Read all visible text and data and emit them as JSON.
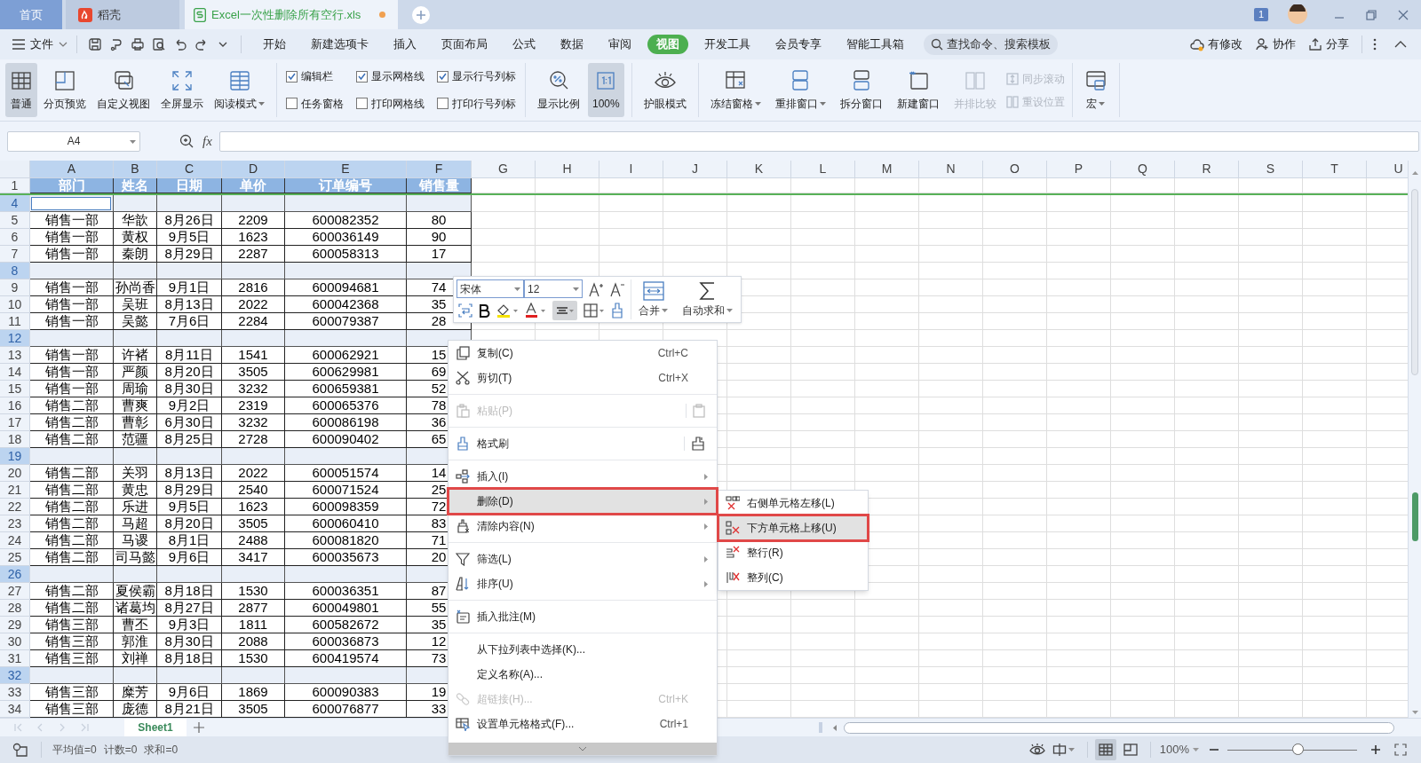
{
  "title_tabs": [
    {
      "kind": "home",
      "label": "首页",
      "selected": false
    },
    {
      "kind": "docer",
      "label": "稻壳",
      "selected": false
    },
    {
      "kind": "sheet",
      "label": "Excel一次性删除所有空行.xls",
      "selected": true,
      "modified": true
    }
  ],
  "notification_count": "1",
  "menu_bar": {
    "file_label": "文件",
    "tabs": [
      {
        "label": "开始",
        "selected": false
      },
      {
        "label": "新建选项卡",
        "selected": false
      },
      {
        "label": "插入",
        "selected": false
      },
      {
        "label": "页面布局",
        "selected": false
      },
      {
        "label": "公式",
        "selected": false
      },
      {
        "label": "数据",
        "selected": false
      },
      {
        "label": "审阅",
        "selected": false
      },
      {
        "label": "视图",
        "selected": true
      },
      {
        "label": "开发工具",
        "selected": false
      },
      {
        "label": "会员专享",
        "selected": false
      },
      {
        "label": "智能工具箱",
        "selected": false
      }
    ],
    "search_placeholder": "查找命令、搜索模板",
    "actions": [
      "有修改",
      "协作",
      "分享"
    ]
  },
  "ribbon": {
    "view_buttons": [
      {
        "label": "普通",
        "selected": true,
        "dropdown": false
      },
      {
        "label": "分页预览",
        "selected": false,
        "dropdown": false
      },
      {
        "label": "自定义视图",
        "selected": false,
        "dropdown": false
      },
      {
        "label": "全屏显示",
        "selected": false,
        "dropdown": false
      },
      {
        "label": "阅读模式",
        "selected": false,
        "dropdown": true
      }
    ],
    "checkboxes": [
      {
        "label": "编辑栏",
        "checked": true
      },
      {
        "label": "任务窗格",
        "checked": false
      },
      {
        "label": "显示网格线",
        "checked": true
      },
      {
        "label": "打印网格线",
        "checked": false
      },
      {
        "label": "显示行号列标",
        "checked": true
      },
      {
        "label": "打印行号列标",
        "checked": false
      }
    ],
    "zoom_buttons": [
      {
        "label": "显示比例",
        "selected": false
      },
      {
        "label": "100%",
        "selected": true
      }
    ],
    "eye_button": "护眼模式",
    "window_buttons": [
      {
        "label": "冻结窗格",
        "dropdown": true,
        "disabled": false
      },
      {
        "label": "重排窗口",
        "dropdown": true,
        "disabled": false
      },
      {
        "label": "拆分窗口",
        "dropdown": false,
        "disabled": false
      },
      {
        "label": "新建窗口",
        "dropdown": false,
        "disabled": false
      },
      {
        "label": "并排比较",
        "dropdown": false,
        "disabled": true
      }
    ],
    "small_buttons": [
      {
        "label": "同步滚动",
        "disabled": true
      },
      {
        "label": "重设位置",
        "disabled": true
      }
    ],
    "macro_button": "宏"
  },
  "formula_bar": {
    "name_box": "A4",
    "fx": "fx"
  },
  "sheet": {
    "columns": [
      {
        "label": "A",
        "selected": true
      },
      {
        "label": "B",
        "selected": true
      },
      {
        "label": "C",
        "selected": true
      },
      {
        "label": "D",
        "selected": true
      },
      {
        "label": "E",
        "selected": true
      },
      {
        "label": "F",
        "selected": true
      },
      {
        "label": "G",
        "selected": false
      },
      {
        "label": "H",
        "selected": false
      },
      {
        "label": "I",
        "selected": false
      },
      {
        "label": "J",
        "selected": false
      },
      {
        "label": "K",
        "selected": false
      },
      {
        "label": "L",
        "selected": false
      },
      {
        "label": "M",
        "selected": false
      },
      {
        "label": "N",
        "selected": false
      },
      {
        "label": "O",
        "selected": false
      },
      {
        "label": "P",
        "selected": false
      },
      {
        "label": "Q",
        "selected": false
      },
      {
        "label": "R",
        "selected": false
      },
      {
        "label": "S",
        "selected": false
      },
      {
        "label": "T",
        "selected": false
      },
      {
        "label": "U",
        "selected": false
      }
    ],
    "rows": [
      {
        "number": "1",
        "kind": "header",
        "selected": false,
        "cells": [
          "部门",
          "姓名",
          "日期",
          "单价",
          "订单编号",
          "销售量"
        ]
      },
      {
        "number": "4",
        "kind": "empty",
        "selected": true,
        "cursor": true
      },
      {
        "number": "5",
        "kind": "data",
        "selected": false,
        "cells": [
          "销售一部",
          "华歆",
          "8月26日",
          "2209",
          "600082352",
          "80"
        ]
      },
      {
        "number": "6",
        "kind": "data",
        "selected": false,
        "cells": [
          "销售一部",
          "黄权",
          "9月5日",
          "1623",
          "600036149",
          "90"
        ]
      },
      {
        "number": "7",
        "kind": "data",
        "selected": false,
        "cells": [
          "销售一部",
          "秦朗",
          "8月29日",
          "2287",
          "600058313",
          "17"
        ]
      },
      {
        "number": "8",
        "kind": "empty",
        "selected": true
      },
      {
        "number": "9",
        "kind": "data",
        "selected": false,
        "cells": [
          "销售一部",
          "孙尚香",
          "9月1日",
          "2816",
          "600094681",
          "74"
        ]
      },
      {
        "number": "10",
        "kind": "data",
        "selected": false,
        "cells": [
          "销售一部",
          "吴班",
          "8月13日",
          "2022",
          "600042368",
          "35"
        ]
      },
      {
        "number": "11",
        "kind": "data",
        "selected": false,
        "cells": [
          "销售一部",
          "吴懿",
          "7月6日",
          "2284",
          "600079387",
          "28"
        ]
      },
      {
        "number": "12",
        "kind": "empty",
        "selected": true
      },
      {
        "number": "13",
        "kind": "data",
        "selected": false,
        "cells": [
          "销售一部",
          "许褚",
          "8月11日",
          "1541",
          "600062921",
          "15"
        ]
      },
      {
        "number": "14",
        "kind": "data",
        "selected": false,
        "cells": [
          "销售一部",
          "严颜",
          "8月20日",
          "3505",
          "600629981",
          "69"
        ]
      },
      {
        "number": "15",
        "kind": "data",
        "selected": false,
        "cells": [
          "销售一部",
          "周瑜",
          "8月30日",
          "3232",
          "600659381",
          "52"
        ]
      },
      {
        "number": "16",
        "kind": "data",
        "selected": false,
        "cells": [
          "销售二部",
          "曹爽",
          "9月2日",
          "2319",
          "600065376",
          "78"
        ]
      },
      {
        "number": "17",
        "kind": "data",
        "selected": false,
        "cells": [
          "销售二部",
          "曹彰",
          "6月30日",
          "3232",
          "600086198",
          "36"
        ]
      },
      {
        "number": "18",
        "kind": "data",
        "selected": false,
        "cells": [
          "销售二部",
          "范疆",
          "8月25日",
          "2728",
          "600090402",
          "65"
        ]
      },
      {
        "number": "19",
        "kind": "empty",
        "selected": true
      },
      {
        "number": "20",
        "kind": "data",
        "selected": false,
        "cells": [
          "销售二部",
          "关羽",
          "8月13日",
          "2022",
          "600051574",
          "14"
        ]
      },
      {
        "number": "21",
        "kind": "data",
        "selected": false,
        "cells": [
          "销售二部",
          "黄忠",
          "8月29日",
          "2540",
          "600071524",
          "25"
        ]
      },
      {
        "number": "22",
        "kind": "data",
        "selected": false,
        "cells": [
          "销售二部",
          "乐进",
          "9月5日",
          "1623",
          "600098359",
          "72"
        ]
      },
      {
        "number": "23",
        "kind": "data",
        "selected": false,
        "cells": [
          "销售二部",
          "马超",
          "8月20日",
          "3505",
          "600060410",
          "83"
        ]
      },
      {
        "number": "24",
        "kind": "data",
        "selected": false,
        "cells": [
          "销售二部",
          "马谡",
          "8月1日",
          "2488",
          "600081820",
          "71"
        ]
      },
      {
        "number": "25",
        "kind": "data",
        "selected": false,
        "cells": [
          "销售二部",
          "司马懿",
          "9月6日",
          "3417",
          "600035673",
          "20"
        ]
      },
      {
        "number": "26",
        "kind": "empty",
        "selected": true
      },
      {
        "number": "27",
        "kind": "data",
        "selected": false,
        "cells": [
          "销售二部",
          "夏侯霸",
          "8月18日",
          "1530",
          "600036351",
          "87"
        ]
      },
      {
        "number": "28",
        "kind": "data",
        "selected": false,
        "cells": [
          "销售二部",
          "诸葛均",
          "8月27日",
          "2877",
          "600049801",
          "55"
        ]
      },
      {
        "number": "29",
        "kind": "data",
        "selected": false,
        "cells": [
          "销售三部",
          "曹丕",
          "9月3日",
          "1811",
          "600582672",
          "35"
        ]
      },
      {
        "number": "30",
        "kind": "data",
        "selected": false,
        "cells": [
          "销售三部",
          "郭淮",
          "8月30日",
          "2088",
          "600036873",
          "12"
        ]
      },
      {
        "number": "31",
        "kind": "data",
        "selected": false,
        "cells": [
          "销售三部",
          "刘禅",
          "8月18日",
          "1530",
          "600419574",
          "73"
        ]
      },
      {
        "number": "32",
        "kind": "empty",
        "selected": true
      },
      {
        "number": "33",
        "kind": "data",
        "selected": false,
        "cells": [
          "销售三部",
          "糜芳",
          "9月6日",
          "1869",
          "600090383",
          "19"
        ]
      },
      {
        "number": "34",
        "kind": "data",
        "selected": false,
        "cells": [
          "销售三部",
          "庞德",
          "8月21日",
          "3505",
          "600076877",
          "33"
        ]
      }
    ]
  },
  "mini_toolbar": {
    "font": "宋体",
    "size": "12",
    "merge": "合并",
    "autosum": "自动求和",
    "align_selected": true
  },
  "context_menu": [
    {
      "kind": "item",
      "label": "复制(C)",
      "shortcut": "Ctrl+C",
      "disabled": false,
      "selected": false,
      "submenu": false
    },
    {
      "kind": "item",
      "label": "剪切(T)",
      "shortcut": "Ctrl+X",
      "disabled": false,
      "selected": false,
      "submenu": false
    },
    {
      "kind": "separator"
    },
    {
      "kind": "item",
      "label": "粘贴(P)",
      "disabled": true,
      "selected": false,
      "submenu": false,
      "side_button": true
    },
    {
      "kind": "separator"
    },
    {
      "kind": "item",
      "label": "格式刷",
      "disabled": false,
      "selected": false,
      "submenu": false,
      "side_button": true
    },
    {
      "kind": "separator"
    },
    {
      "kind": "item",
      "label": "插入(I)",
      "disabled": false,
      "selected": false,
      "submenu": true
    },
    {
      "kind": "item",
      "label": "删除(D)",
      "disabled": false,
      "selected": true,
      "outlined": true,
      "submenu": true
    },
    {
      "kind": "item",
      "label": "清除内容(N)",
      "disabled": false,
      "selected": false,
      "submenu": true
    },
    {
      "kind": "separator"
    },
    {
      "kind": "item",
      "label": "筛选(L)",
      "disabled": false,
      "selected": false,
      "submenu": true
    },
    {
      "kind": "item",
      "label": "排序(U)",
      "disabled": false,
      "selected": false,
      "submenu": true
    },
    {
      "kind": "separator"
    },
    {
      "kind": "item",
      "label": "插入批注(M)",
      "disabled": false,
      "selected": false,
      "submenu": false
    },
    {
      "kind": "separator"
    },
    {
      "kind": "item",
      "label": "从下拉列表中选择(K)...",
      "disabled": false,
      "selected": false,
      "submenu": false
    },
    {
      "kind": "item",
      "label": "定义名称(A)...",
      "disabled": false,
      "selected": false,
      "submenu": false
    },
    {
      "kind": "item",
      "label": "超链接(H)...",
      "shortcut": "Ctrl+K",
      "disabled": true,
      "selected": false,
      "submenu": false
    },
    {
      "kind": "item",
      "label": "设置单元格格式(F)...",
      "shortcut": "Ctrl+1",
      "disabled": false,
      "selected": false,
      "submenu": false
    }
  ],
  "submenu": [
    {
      "label": "右侧单元格左移(L)",
      "selected": false,
      "outlined": false
    },
    {
      "label": "下方单元格上移(U)",
      "selected": true,
      "outlined": true
    },
    {
      "label": "整行(R)",
      "selected": false,
      "outlined": false
    },
    {
      "label": "整列(C)",
      "selected": false,
      "outlined": false
    }
  ],
  "sheet_tabs": [
    {
      "label": "Sheet1",
      "selected": true
    }
  ],
  "status_bar": {
    "stats": [
      "平均值=0",
      "计数=0",
      "求和=0"
    ],
    "zoom": "100%",
    "zoom_slider": {
      "level": 0.55
    },
    "views": [
      {
        "selected": true
      },
      {
        "selected": false
      }
    ]
  }
}
